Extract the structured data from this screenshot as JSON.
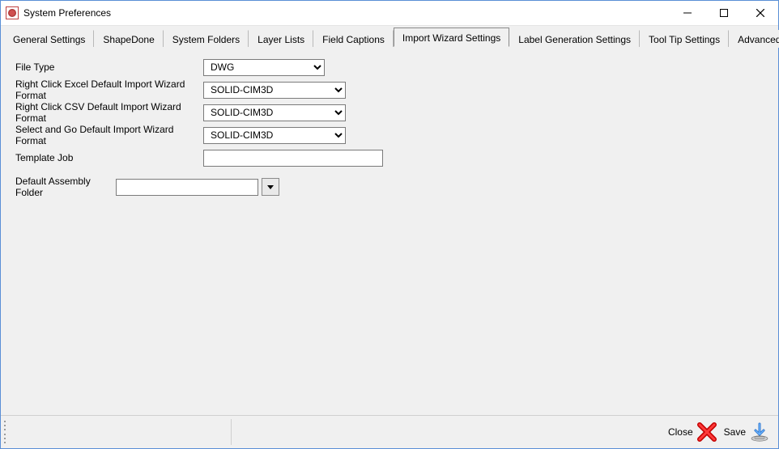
{
  "window": {
    "title": "System Preferences"
  },
  "tabs": [
    {
      "label": "General Settings"
    },
    {
      "label": "ShapeDone"
    },
    {
      "label": "System Folders"
    },
    {
      "label": "Layer Lists"
    },
    {
      "label": "Field Captions"
    },
    {
      "label": "Import Wizard Settings"
    },
    {
      "label": "Label Generation Settings"
    },
    {
      "label": "Tool Tip Settings"
    },
    {
      "label": "Advanced Settings"
    }
  ],
  "active_tab_index": 5,
  "form": {
    "file_type": {
      "label": "File Type",
      "value": "DWG"
    },
    "excel_format": {
      "label": "Right Click Excel Default Import Wizard Format",
      "value": "SOLID-CIM3D"
    },
    "csv_format": {
      "label": "Right Click CSV Default Import Wizard Format",
      "value": "SOLID-CIM3D"
    },
    "selectgo_format": {
      "label": "Select and Go Default Import Wizard Format",
      "value": "SOLID-CIM3D"
    },
    "template_job": {
      "label": "Template Job",
      "value": ""
    },
    "assembly_folder": {
      "label": "Default Assembly Folder",
      "value": ""
    }
  },
  "footer": {
    "close": "Close",
    "save": "Save"
  }
}
